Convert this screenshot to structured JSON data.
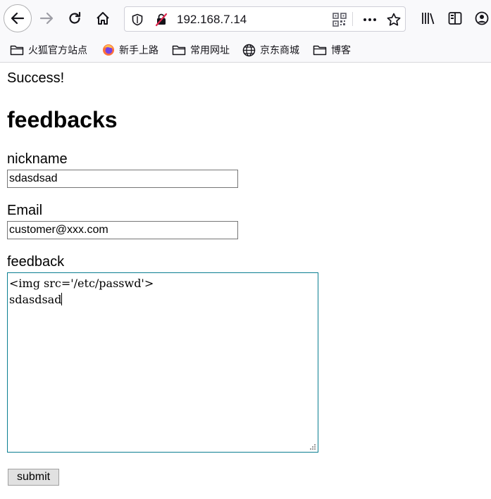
{
  "browser": {
    "url": "192.168.7.14",
    "bookmarks": [
      {
        "label": "火狐官方站点",
        "icon": "folder-icon"
      },
      {
        "label": "新手上路",
        "icon": "firefox-icon"
      },
      {
        "label": "常用网址",
        "icon": "folder-icon"
      },
      {
        "label": "京东商城",
        "icon": "globe-icon"
      },
      {
        "label": "博客",
        "icon": "folder-icon"
      }
    ]
  },
  "page": {
    "status": "Success!",
    "heading": "feedbacks",
    "nickname": {
      "label": "nickname",
      "value": "sdasdsad"
    },
    "email": {
      "label": "Email",
      "value": "customer@xxx.com"
    },
    "feedback": {
      "label": "feedback",
      "line1": "<img src='/etc/passwd'>",
      "line2": "sdasdsad"
    },
    "submit_label": "submit"
  }
}
